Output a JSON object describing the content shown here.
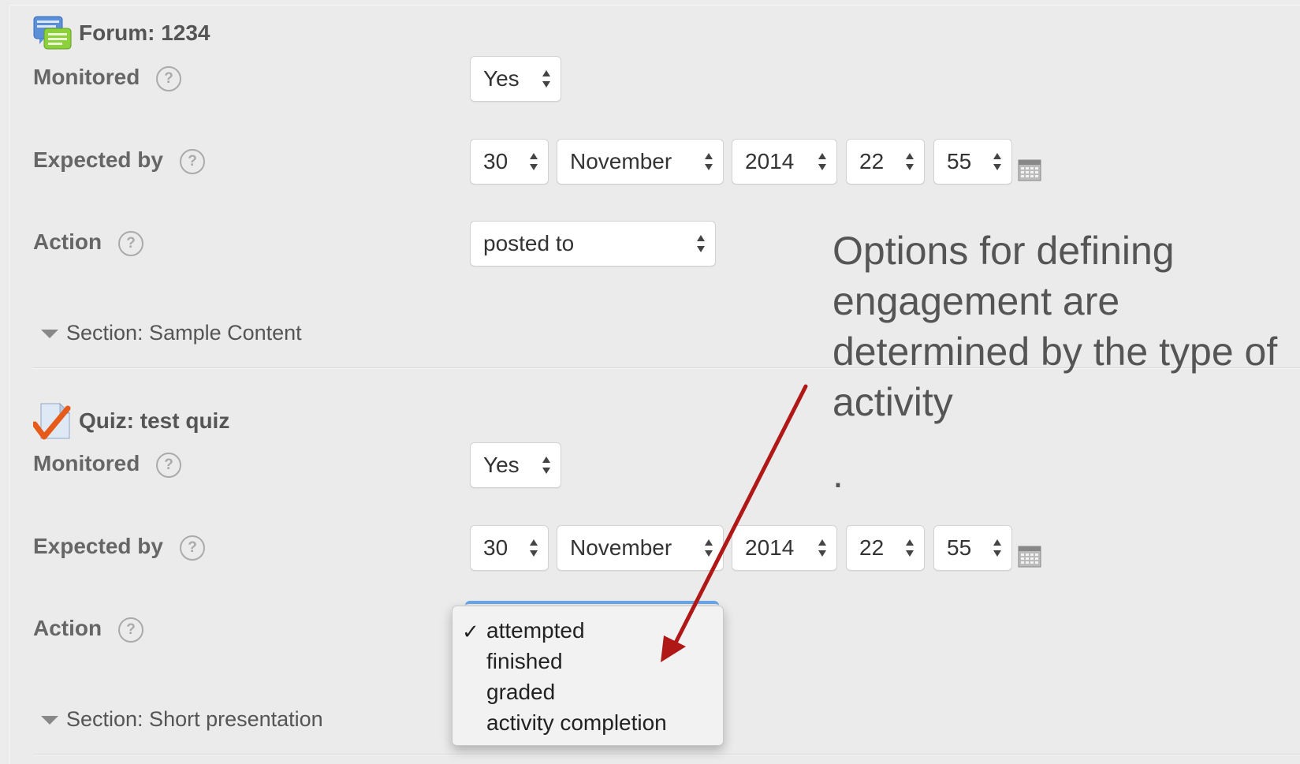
{
  "forum": {
    "title": "Forum: 1234",
    "monitored_label": "Monitored",
    "monitored_value": "Yes",
    "expected_label": "Expected by",
    "day": "30",
    "month": "November",
    "year": "2014",
    "hour": "22",
    "minute": "55",
    "action_label": "Action",
    "action_value": "posted to",
    "section": "Section: Sample Content"
  },
  "quiz": {
    "title": "Quiz: test quiz",
    "monitored_label": "Monitored",
    "monitored_value": "Yes",
    "expected_label": "Expected by",
    "day": "30",
    "month": "November",
    "year": "2014",
    "hour": "22",
    "minute": "55",
    "action_label": "Action",
    "action_options": [
      "attempted",
      "finished",
      "graded",
      "activity completion"
    ],
    "selected_option": "attempted",
    "check_mark": "✓",
    "section": "Section: Short presentation"
  },
  "help_glyph": "?",
  "annotation": {
    "text": "Options for defining engagement are determined by the type of activity",
    "dot": "."
  },
  "icons": {
    "forum": "forum-chat-bubbles-icon",
    "quiz": "quiz-checkmark-icon",
    "help": "question-circle-icon",
    "calendar": "calendar-icon",
    "select_arrows": "up-down-arrows-icon"
  },
  "colors": {
    "arrow": "#b01818",
    "focus": "#6aa6e6"
  }
}
